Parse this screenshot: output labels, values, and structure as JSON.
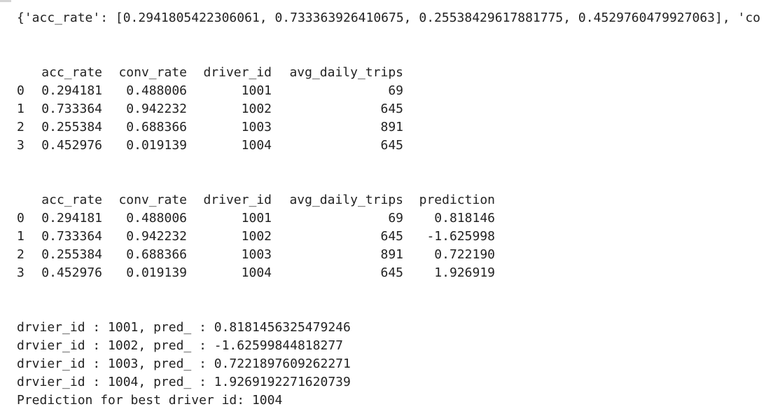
{
  "dict_line": "{'acc_rate': [0.2941805422306061, 0.733363926410675, 0.25538429617881775, 0.4529760479927063], 'co",
  "table1": {
    "columns": [
      "",
      "acc_rate",
      "conv_rate",
      "driver_id",
      "avg_daily_trips"
    ],
    "rows": [
      [
        "0",
        "0.294181",
        "0.488006",
        "1001",
        "69"
      ],
      [
        "1",
        "0.733364",
        "0.942232",
        "1002",
        "645"
      ],
      [
        "2",
        "0.255384",
        "0.688366",
        "1003",
        "891"
      ],
      [
        "3",
        "0.452976",
        "0.019139",
        "1004",
        "645"
      ]
    ]
  },
  "table2": {
    "columns": [
      "",
      "acc_rate",
      "conv_rate",
      "driver_id",
      "avg_daily_trips",
      "prediction"
    ],
    "rows": [
      [
        "0",
        "0.294181",
        "0.488006",
        "1001",
        "69",
        "0.818146"
      ],
      [
        "1",
        "0.733364",
        "0.942232",
        "1002",
        "645",
        "-1.625998"
      ],
      [
        "2",
        "0.255384",
        "0.688366",
        "1003",
        "891",
        "0.722190"
      ],
      [
        "3",
        "0.452976",
        "0.019139",
        "1004",
        "645",
        "1.926919"
      ]
    ]
  },
  "log_lines": [
    "drvier_id : 1001, pred_ : 0.8181456325479246",
    "drvier_id : 1002, pred_ : -1.62599844818277",
    "drvier_id : 1003, pred_ : 0.7221897609262271",
    "drvier_id : 1004, pred_ : 1.9269192271620739",
    "Prediction for best driver id: 1004"
  ]
}
